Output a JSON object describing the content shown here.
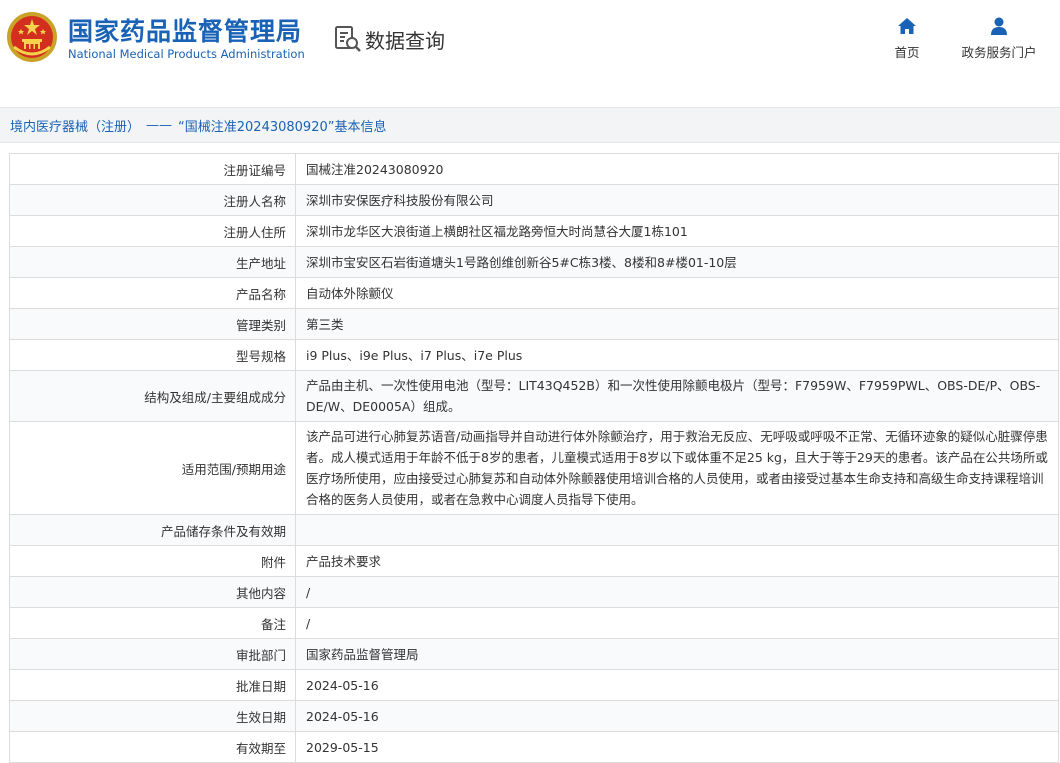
{
  "header": {
    "brand_cn": "国家药品监督管理局",
    "brand_en": "National Medical Products Administration",
    "query_label": "数据查询",
    "nav": {
      "home_label": "首页",
      "home_icon": "home-icon",
      "service_label": "政务服务门户",
      "service_icon": "user-icon"
    },
    "accent_color": "#1a62b5"
  },
  "breadcrumb": {
    "section": "境内医疗器械（注册）",
    "separator": "——",
    "current": "“国械注准20243080920”基本信息"
  },
  "rows": [
    {
      "label": "注册证编号",
      "value": "国械注准20243080920"
    },
    {
      "label": "注册人名称",
      "value": "深圳市安保医疗科技股份有限公司"
    },
    {
      "label": "注册人住所",
      "value": "深圳市龙华区大浪街道上横朗社区福龙路旁恒大时尚慧谷大厦1栋101"
    },
    {
      "label": "生产地址",
      "value": "深圳市宝安区石岩街道塘头1号路创维创新谷5#C栋3楼、8楼和8#楼01-10层"
    },
    {
      "label": "产品名称",
      "value": "自动体外除颤仪"
    },
    {
      "label": "管理类别",
      "value": "第三类"
    },
    {
      "label": "型号规格",
      "value": "i9 Plus、i9e Plus、i7 Plus、i7e Plus"
    },
    {
      "label": "结构及组成/主要组成成分",
      "value": "产品由主机、一次性使用电池（型号：LIT43Q452B）和一次性使用除颤电极片（型号：F7959W、F7959PWL、OBS-DE/P、OBS-DE/W、DE0005A）组成。"
    },
    {
      "label": "适用范围/预期用途",
      "value": "该产品可进行心肺复苏语音/动画指导并自动进行体外除颤治疗，用于救治无反应、无呼吸或呼吸不正常、无循环迹象的疑似心脏骤停患者。成人模式适用于年龄不低于8岁的患者，儿童模式适用于8岁以下或体重不足25 kg，且大于等于29天的患者。该产品在公共场所或医疗场所使用，应由接受过心肺复苏和自动体外除颤器使用培训合格的人员使用，或者由接受过基本生命支持和高级生命支持课程培训合格的医务人员使用，或者在急救中心调度人员指导下使用。"
    },
    {
      "label": "产品储存条件及有效期",
      "value": ""
    },
    {
      "label": "附件",
      "value": "产品技术要求"
    },
    {
      "label": "其他内容",
      "value": "/"
    },
    {
      "label": "备注",
      "value": "/"
    },
    {
      "label": "审批部门",
      "value": "国家药品监督管理局"
    },
    {
      "label": "批准日期",
      "value": "2024-05-16"
    },
    {
      "label": "生效日期",
      "value": "2024-05-16"
    },
    {
      "label": "有效期至",
      "value": "2029-05-15"
    }
  ]
}
